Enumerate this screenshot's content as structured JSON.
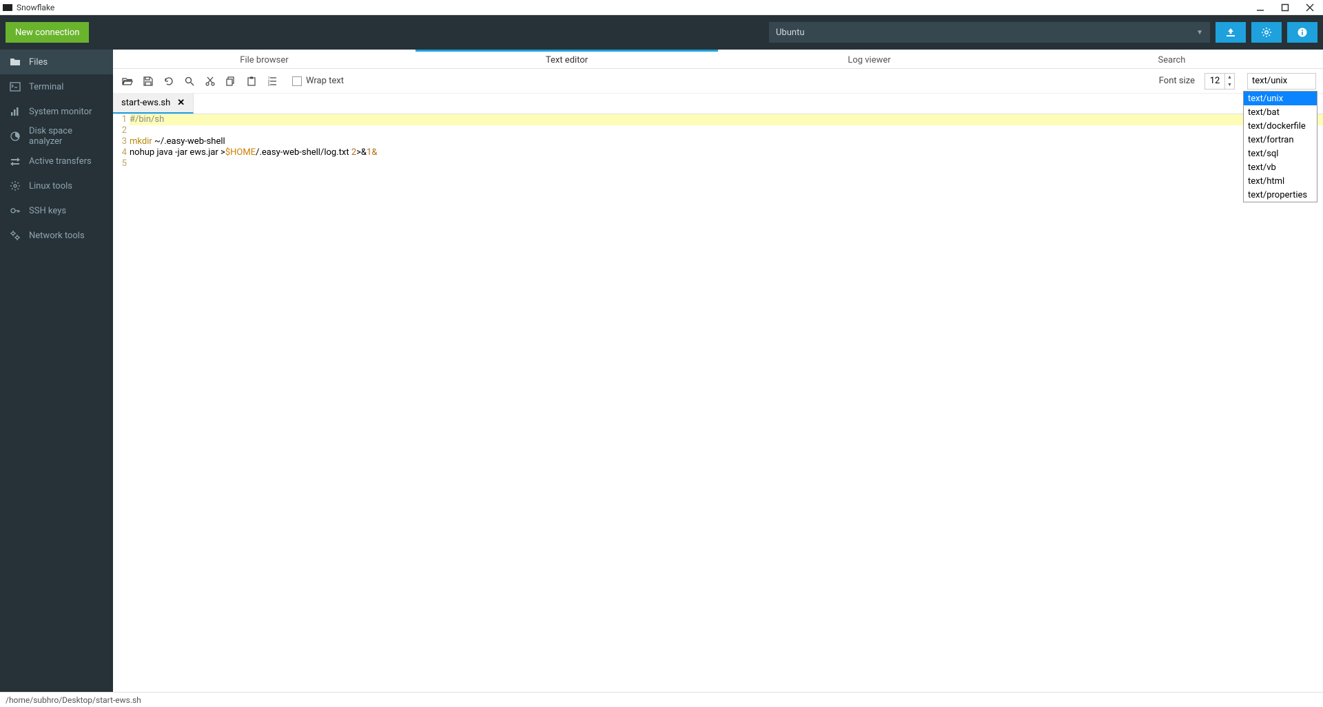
{
  "app": {
    "title": "Snowflake"
  },
  "header": {
    "new_connection": "New connection",
    "connection_name": "Ubuntu"
  },
  "sidebar": {
    "items": [
      {
        "label": "Files"
      },
      {
        "label": "Terminal"
      },
      {
        "label": "System monitor"
      },
      {
        "label": "Disk space analyzer"
      },
      {
        "label": "Active transfers"
      },
      {
        "label": "Linux tools"
      },
      {
        "label": "SSH keys"
      },
      {
        "label": "Network tools"
      }
    ]
  },
  "tabs": {
    "items": [
      {
        "label": "File browser"
      },
      {
        "label": "Text editor"
      },
      {
        "label": "Log viewer"
      },
      {
        "label": "Search"
      }
    ]
  },
  "toolbar": {
    "wrap_text": "Wrap text",
    "font_size_label": "Font size",
    "font_size_value": "12",
    "syntax_value": "text/unix"
  },
  "syntax_options": [
    "text/unix",
    "text/bat",
    "text/dockerfile",
    "text/fortran",
    "text/sql",
    "text/vb",
    "text/html",
    "text/properties"
  ],
  "file_tabs": [
    {
      "name": "start-ews.sh"
    }
  ],
  "editor": {
    "lines": [
      {
        "n": "1",
        "segments": [
          {
            "cls": "tok-comment",
            "t": "#/bin/sh"
          }
        ],
        "hl": true
      },
      {
        "n": "2",
        "segments": [
          {
            "cls": "",
            "t": ""
          }
        ]
      },
      {
        "n": "3",
        "segments": [
          {
            "cls": "tok-cmd",
            "t": "mkdir"
          },
          {
            "cls": "",
            "t": " ~/.easy-web-shell"
          }
        ]
      },
      {
        "n": "4",
        "segments": [
          {
            "cls": "",
            "t": "nohup java -jar ews.jar >"
          },
          {
            "cls": "tok-var",
            "t": "$HOME"
          },
          {
            "cls": "",
            "t": "/.easy-web-shell/log.txt "
          },
          {
            "cls": "tok-num",
            "t": "2"
          },
          {
            "cls": "",
            "t": ">&"
          },
          {
            "cls": "tok-num",
            "t": "1"
          },
          {
            "cls": "tok-amp",
            "t": "&"
          }
        ]
      },
      {
        "n": "5",
        "segments": [
          {
            "cls": "",
            "t": ""
          }
        ]
      }
    ]
  },
  "status": {
    "path": "/home/subhro/Desktop/start-ews.sh"
  }
}
